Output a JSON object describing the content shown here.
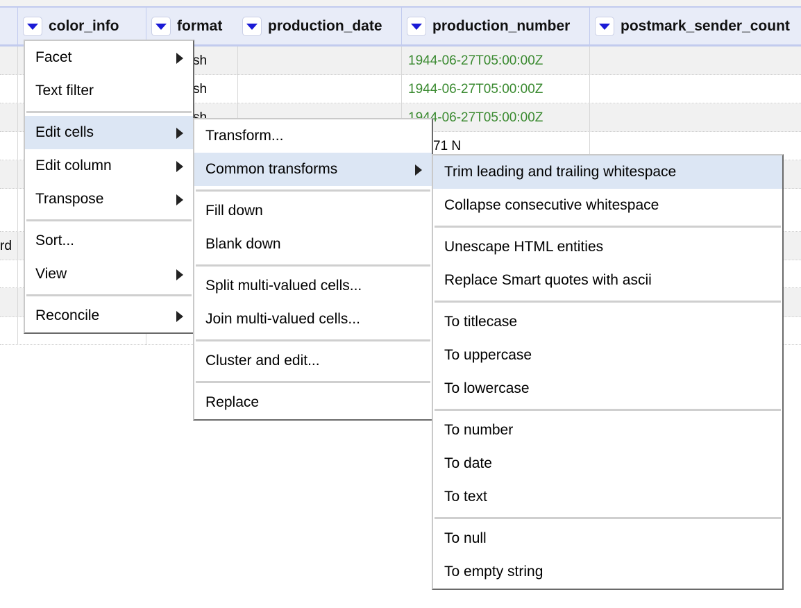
{
  "table": {
    "columns": [
      {
        "name": "",
        "has_dropdown": false
      },
      {
        "name": "color_info",
        "has_dropdown": true
      },
      {
        "name": "format",
        "has_dropdown": true
      },
      {
        "name": "production_date",
        "has_dropdown": true
      },
      {
        "name": "production_number",
        "has_dropdown": true
      },
      {
        "name": "postmark_sender_count",
        "has_dropdown": true
      }
    ],
    "visible_cells": {
      "format_partial": [
        "sh",
        "sh",
        "sh"
      ],
      "production_number": [
        "1944-06-27T05:00:00Z",
        "1944-06-27T05:00:00Z",
        "1944-06-27T05:00:00Z",
        "71 N"
      ],
      "first_col_partial_row7": "rd"
    },
    "colors": {
      "date_text": "#3a8a30",
      "header_bg": "#e8ecf8",
      "dropdown_arrow": "#1a1ad6",
      "highlight": "#dce6f4"
    }
  },
  "column_menu": {
    "items": [
      {
        "label": "Facet",
        "submenu": true
      },
      {
        "label": "Text filter",
        "submenu": false
      },
      {
        "separator": true
      },
      {
        "label": "Edit cells",
        "submenu": true,
        "active": true
      },
      {
        "label": "Edit column",
        "submenu": true
      },
      {
        "label": "Transpose",
        "submenu": true
      },
      {
        "separator": true
      },
      {
        "label": "Sort...",
        "submenu": false
      },
      {
        "label": "View",
        "submenu": true
      },
      {
        "separator": true
      },
      {
        "label": "Reconcile",
        "submenu": true
      }
    ]
  },
  "edit_cells_menu": {
    "items": [
      {
        "label": "Transform...",
        "submenu": false
      },
      {
        "label": "Common transforms",
        "submenu": true,
        "active": true
      },
      {
        "separator": true
      },
      {
        "label": "Fill down",
        "submenu": false
      },
      {
        "label": "Blank down",
        "submenu": false
      },
      {
        "separator": true
      },
      {
        "label": "Split multi-valued cells...",
        "submenu": false
      },
      {
        "label": "Join multi-valued cells...",
        "submenu": false
      },
      {
        "separator": true
      },
      {
        "label": "Cluster and edit...",
        "submenu": false
      },
      {
        "separator": true
      },
      {
        "label": "Replace",
        "submenu": false
      }
    ]
  },
  "common_transforms_menu": {
    "items": [
      {
        "label": "Trim leading and trailing whitespace",
        "active": true
      },
      {
        "label": "Collapse consecutive whitespace"
      },
      {
        "separator": true
      },
      {
        "label": "Unescape HTML entities"
      },
      {
        "label": "Replace Smart quotes with ascii"
      },
      {
        "separator": true
      },
      {
        "label": "To titlecase"
      },
      {
        "label": "To uppercase"
      },
      {
        "label": "To lowercase"
      },
      {
        "separator": true
      },
      {
        "label": "To number"
      },
      {
        "label": "To date"
      },
      {
        "label": "To text"
      },
      {
        "separator": true
      },
      {
        "label": "To null"
      },
      {
        "label": "To empty string"
      }
    ]
  }
}
